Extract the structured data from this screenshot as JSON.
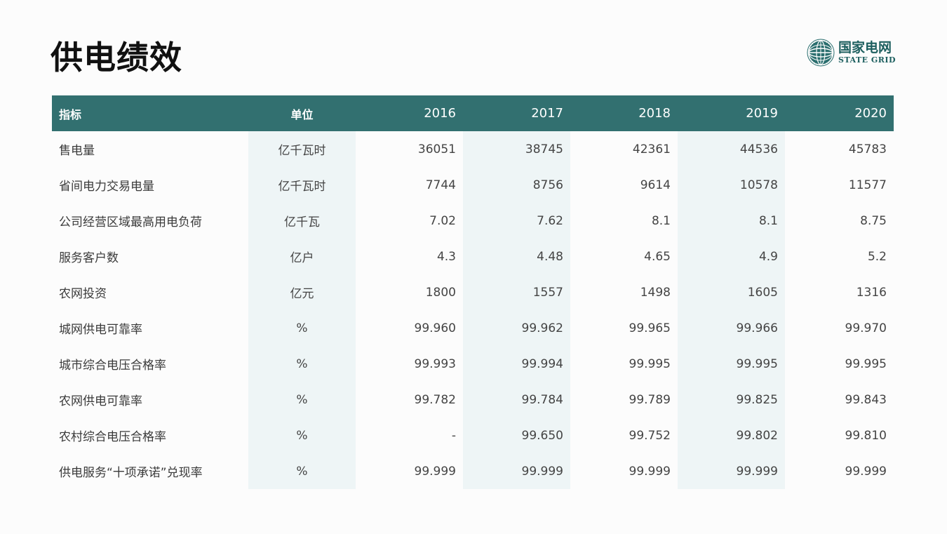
{
  "page": {
    "title": "供电绩效"
  },
  "logo": {
    "name_cn": "国家电网",
    "name_en": "STATE GRID",
    "emblem_icon": "globe-emblem-icon"
  },
  "colors": {
    "header_bg": "#327070",
    "header_text": "#ffffff",
    "column_shade": "#eef5f6",
    "logo": "#1d5f5f"
  },
  "table": {
    "headers": {
      "indicator": "指标",
      "unit": "单位",
      "years": [
        "2016",
        "2017",
        "2018",
        "2019",
        "2020"
      ]
    },
    "rows": [
      {
        "name": "售电量",
        "unit": "亿千瓦时",
        "values": [
          "36051",
          "38745",
          "42361",
          "44536",
          "45783"
        ]
      },
      {
        "name": "省间电力交易电量",
        "unit": "亿千瓦时",
        "values": [
          "7744",
          "8756",
          "9614",
          "10578",
          "11577"
        ]
      },
      {
        "name": "公司经营区域最高用电负荷",
        "unit": "亿千瓦",
        "values": [
          "7.02",
          "7.62",
          "8.1",
          "8.1",
          "8.75"
        ]
      },
      {
        "name": "服务客户数",
        "unit": "亿户",
        "values": [
          "4.3",
          "4.48",
          "4.65",
          "4.9",
          "5.2"
        ]
      },
      {
        "name": "农网投资",
        "unit": "亿元",
        "values": [
          "1800",
          "1557",
          "1498",
          "1605",
          "1316"
        ]
      },
      {
        "name": "城网供电可靠率",
        "unit": "%",
        "values": [
          "99.960",
          "99.962",
          "99.965",
          "99.966",
          "99.970"
        ]
      },
      {
        "name": "城市综合电压合格率",
        "unit": "%",
        "values": [
          "99.993",
          "99.994",
          "99.995",
          "99.995",
          "99.995"
        ]
      },
      {
        "name": "农网供电可靠率",
        "unit": "%",
        "values": [
          "99.782",
          "99.784",
          "99.789",
          "99.825",
          "99.843"
        ]
      },
      {
        "name": "农村综合电压合格率",
        "unit": "%",
        "values": [
          "-",
          "99.650",
          "99.752",
          "99.802",
          "99.810"
        ]
      },
      {
        "name": "供电服务“十项承诺”兑现率",
        "unit": "%",
        "values": [
          "99.999",
          "99.999",
          "99.999",
          "99.999",
          "99.999"
        ]
      }
    ]
  }
}
